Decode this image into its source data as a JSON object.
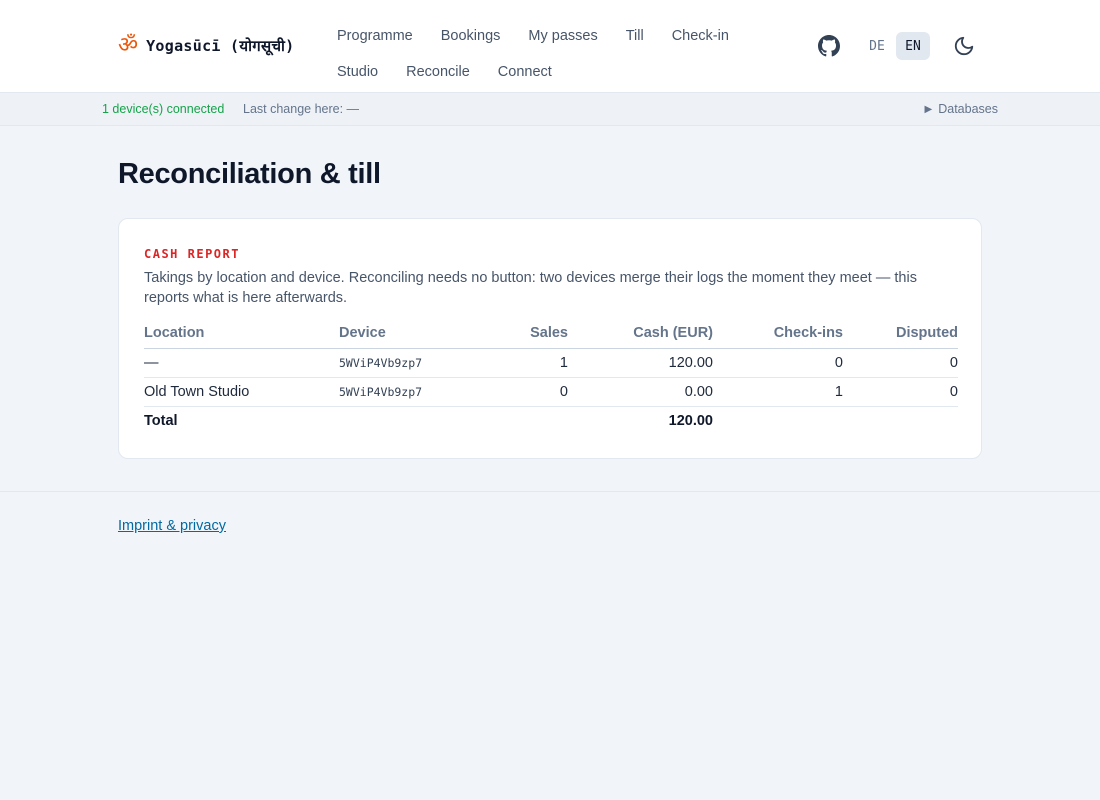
{
  "header": {
    "brand_glyph": "ॐ",
    "brand_name": "Yogasūcī (योगसूची)",
    "nav": [
      [
        "Programme",
        "Bookings",
        "My passes",
        "Till",
        "Check-in"
      ],
      [
        "Studio",
        "Reconcile",
        "Connect"
      ]
    ],
    "languages": [
      "DE",
      "EN"
    ],
    "active_language": "EN",
    "icons": {
      "github": "github-icon",
      "theme": "moon-icon"
    }
  },
  "statusbar": {
    "connected": "1 device(s) connected",
    "last_change": "Last change here: —",
    "databases": "Databases"
  },
  "page": {
    "title": "Reconciliation & till"
  },
  "cash_report": {
    "label": "CASH REPORT",
    "description": "Takings by location and device. Reconciling needs no button: two devices merge their logs the moment they meet — this reports what is here afterwards.",
    "columns": [
      "Location",
      "Device",
      "Sales",
      "Cash (EUR)",
      "Check-ins",
      "Disputed"
    ],
    "rows": [
      [
        "—",
        "5WViP4Vb9zp7",
        "1",
        "120.00",
        "0",
        "0"
      ],
      [
        "Old Town Studio",
        "5WViP4Vb9zp7",
        "0",
        "0.00",
        "1",
        "0"
      ]
    ],
    "total": {
      "label": "Total",
      "cash": "120.00"
    }
  },
  "footer": {
    "imprint": "Imprint & privacy"
  },
  "colors": {
    "accent_red": "#dc2626",
    "connected_green": "#16a34a",
    "link_blue": "#0369a1"
  }
}
